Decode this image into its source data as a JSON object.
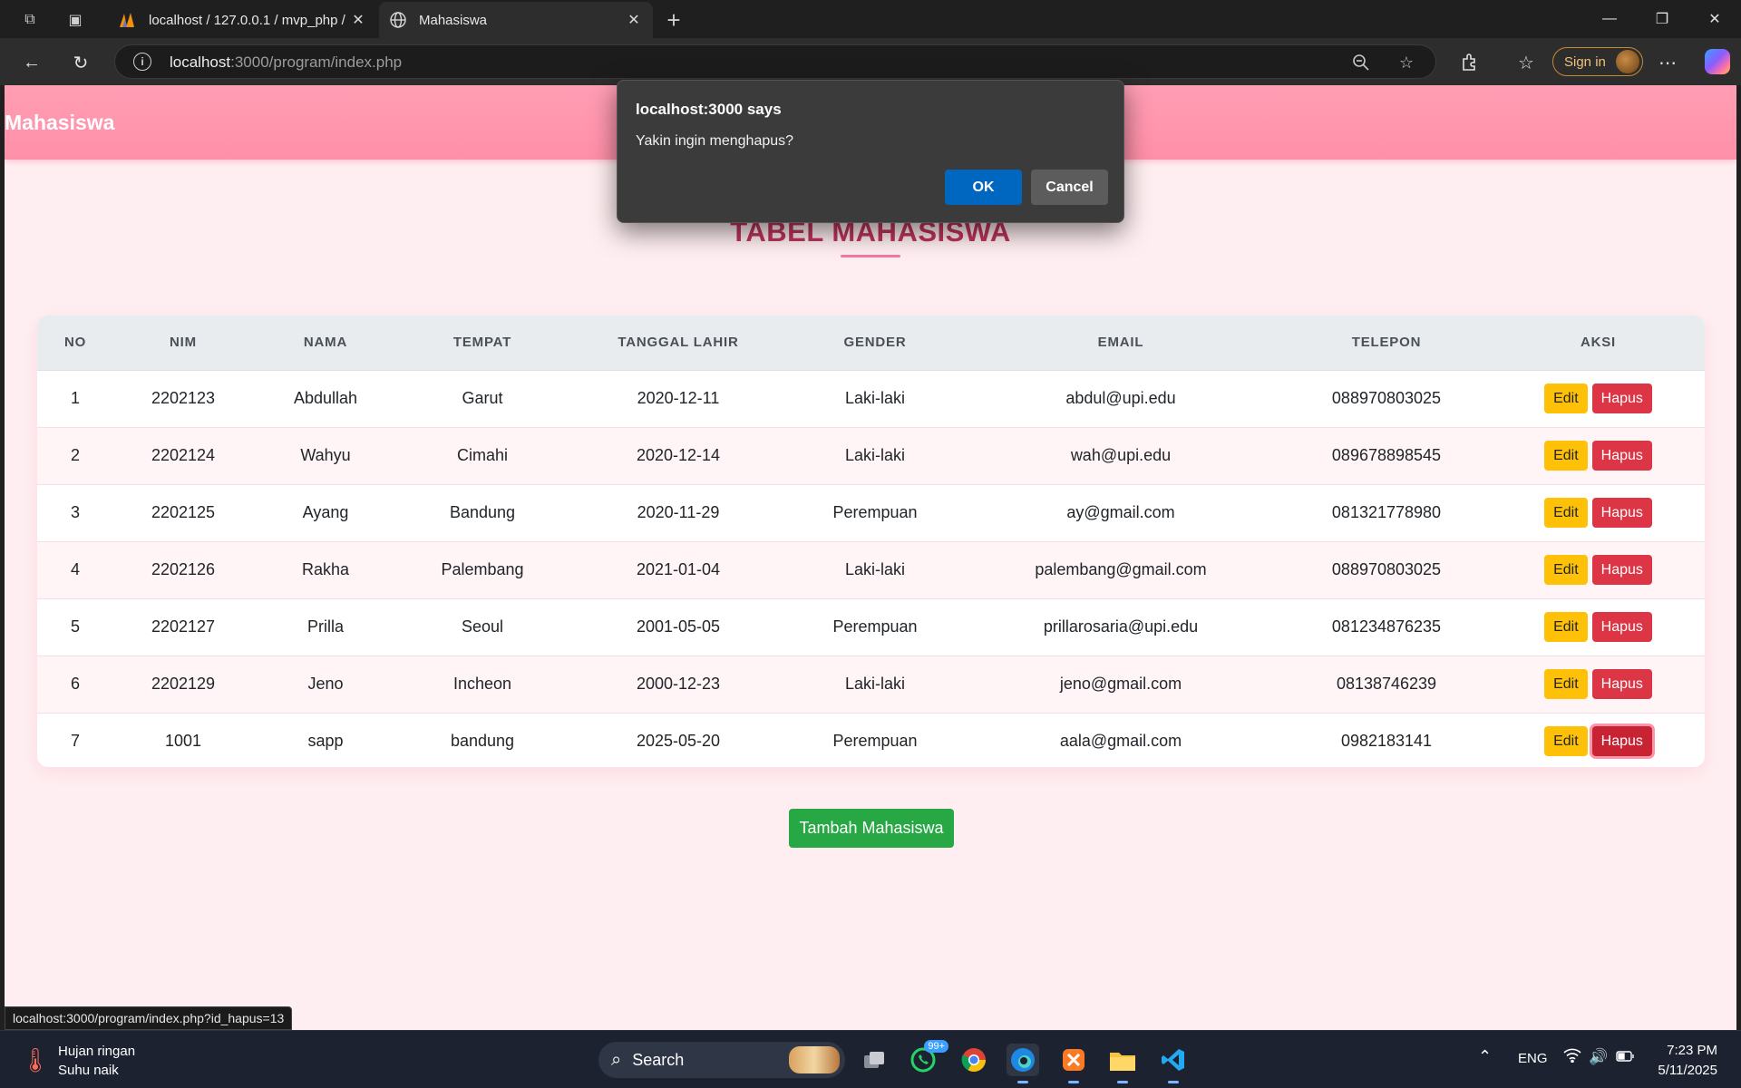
{
  "browser": {
    "tabs": [
      {
        "title": "localhost / 127.0.0.1 / mvp_php / ",
        "close": "✕"
      },
      {
        "title": "Mahasiswa",
        "close": "✕"
      }
    ],
    "new_tab": "+",
    "url_host": "localhost",
    "url_rest": ":3000/program/index.php",
    "signin_label": "Sign in",
    "status_url": "localhost:3000/program/index.php?id_hapus=13"
  },
  "app": {
    "title": "Mahasiswa",
    "heading": "TABEL MAHASISWA",
    "columns": [
      "NO",
      "NIM",
      "NAMA",
      "TEMPAT",
      "TANGGAL LAHIR",
      "GENDER",
      "EMAIL",
      "TELEPON",
      "AKSI"
    ],
    "rows": [
      {
        "no": "1",
        "nim": "2202123",
        "nama": "Abdullah",
        "tempat": "Garut",
        "tgl": "2020-12-11",
        "gender": "Laki-laki",
        "email": "abdul@upi.edu",
        "telp": "088970803025"
      },
      {
        "no": "2",
        "nim": "2202124",
        "nama": "Wahyu",
        "tempat": "Cimahi",
        "tgl": "2020-12-14",
        "gender": "Laki-laki",
        "email": "wah@upi.edu",
        "telp": "089678898545"
      },
      {
        "no": "3",
        "nim": "2202125",
        "nama": "Ayang",
        "tempat": "Bandung",
        "tgl": "2020-11-29",
        "gender": "Perempuan",
        "email": "ay@gmail.com",
        "telp": "081321778980"
      },
      {
        "no": "4",
        "nim": "2202126",
        "nama": "Rakha",
        "tempat": "Palembang",
        "tgl": "2021-01-04",
        "gender": "Laki-laki",
        "email": "palembang@gmail.com",
        "telp": "088970803025"
      },
      {
        "no": "5",
        "nim": "2202127",
        "nama": "Prilla",
        "tempat": "Seoul",
        "tgl": "2001-05-05",
        "gender": "Perempuan",
        "email": "prillarosaria@upi.edu",
        "telp": "081234876235"
      },
      {
        "no": "6",
        "nim": "2202129",
        "nama": "Jeno",
        "tempat": "Incheon",
        "tgl": "2000-12-23",
        "gender": "Laki-laki",
        "email": "jeno@gmail.com",
        "telp": "08138746239"
      },
      {
        "no": "7",
        "nim": "1001",
        "nama": "sapp",
        "tempat": "bandung",
        "tgl": "2025-05-20",
        "gender": "Perempuan",
        "email": "aala@gmail.com",
        "telp": "0982183141"
      }
    ],
    "edit_label": "Edit",
    "delete_label": "Hapus",
    "add_label": "Tambah Mahasiswa"
  },
  "dialog": {
    "title": "localhost:3000 says",
    "message": "Yakin ingin menghapus?",
    "ok_label": "OK",
    "cancel_label": "Cancel"
  },
  "taskbar": {
    "weather_line1": "Hujan ringan",
    "weather_line2": "Suhu naik",
    "search_label": "Search",
    "whatsapp_badge": "99+",
    "language": "ENG",
    "time": "7:23 PM",
    "date": "5/11/2025"
  },
  "colors": {
    "header_pink": "#ff9eb4",
    "heading_text": "#c2335c",
    "page_bg": "#ffeef1",
    "edit_button": "#ffc107",
    "delete_button": "#dc3545",
    "add_button": "#28a745",
    "dialog_ok": "#0067c0"
  }
}
